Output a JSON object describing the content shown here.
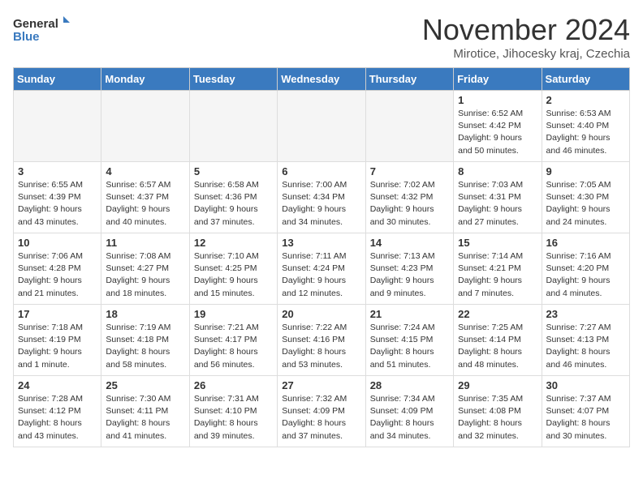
{
  "logo": {
    "text_general": "General",
    "text_blue": "Blue"
  },
  "header": {
    "month_year": "November 2024",
    "location": "Mirotice, Jihocesky kraj, Czechia"
  },
  "days_of_week": [
    "Sunday",
    "Monday",
    "Tuesday",
    "Wednesday",
    "Thursday",
    "Friday",
    "Saturday"
  ],
  "weeks": [
    [
      {
        "day": "",
        "info": ""
      },
      {
        "day": "",
        "info": ""
      },
      {
        "day": "",
        "info": ""
      },
      {
        "day": "",
        "info": ""
      },
      {
        "day": "",
        "info": ""
      },
      {
        "day": "1",
        "info": "Sunrise: 6:52 AM\nSunset: 4:42 PM\nDaylight: 9 hours and 50 minutes."
      },
      {
        "day": "2",
        "info": "Sunrise: 6:53 AM\nSunset: 4:40 PM\nDaylight: 9 hours and 46 minutes."
      }
    ],
    [
      {
        "day": "3",
        "info": "Sunrise: 6:55 AM\nSunset: 4:39 PM\nDaylight: 9 hours and 43 minutes."
      },
      {
        "day": "4",
        "info": "Sunrise: 6:57 AM\nSunset: 4:37 PM\nDaylight: 9 hours and 40 minutes."
      },
      {
        "day": "5",
        "info": "Sunrise: 6:58 AM\nSunset: 4:36 PM\nDaylight: 9 hours and 37 minutes."
      },
      {
        "day": "6",
        "info": "Sunrise: 7:00 AM\nSunset: 4:34 PM\nDaylight: 9 hours and 34 minutes."
      },
      {
        "day": "7",
        "info": "Sunrise: 7:02 AM\nSunset: 4:32 PM\nDaylight: 9 hours and 30 minutes."
      },
      {
        "day": "8",
        "info": "Sunrise: 7:03 AM\nSunset: 4:31 PM\nDaylight: 9 hours and 27 minutes."
      },
      {
        "day": "9",
        "info": "Sunrise: 7:05 AM\nSunset: 4:30 PM\nDaylight: 9 hours and 24 minutes."
      }
    ],
    [
      {
        "day": "10",
        "info": "Sunrise: 7:06 AM\nSunset: 4:28 PM\nDaylight: 9 hours and 21 minutes."
      },
      {
        "day": "11",
        "info": "Sunrise: 7:08 AM\nSunset: 4:27 PM\nDaylight: 9 hours and 18 minutes."
      },
      {
        "day": "12",
        "info": "Sunrise: 7:10 AM\nSunset: 4:25 PM\nDaylight: 9 hours and 15 minutes."
      },
      {
        "day": "13",
        "info": "Sunrise: 7:11 AM\nSunset: 4:24 PM\nDaylight: 9 hours and 12 minutes."
      },
      {
        "day": "14",
        "info": "Sunrise: 7:13 AM\nSunset: 4:23 PM\nDaylight: 9 hours and 9 minutes."
      },
      {
        "day": "15",
        "info": "Sunrise: 7:14 AM\nSunset: 4:21 PM\nDaylight: 9 hours and 7 minutes."
      },
      {
        "day": "16",
        "info": "Sunrise: 7:16 AM\nSunset: 4:20 PM\nDaylight: 9 hours and 4 minutes."
      }
    ],
    [
      {
        "day": "17",
        "info": "Sunrise: 7:18 AM\nSunset: 4:19 PM\nDaylight: 9 hours and 1 minute."
      },
      {
        "day": "18",
        "info": "Sunrise: 7:19 AM\nSunset: 4:18 PM\nDaylight: 8 hours and 58 minutes."
      },
      {
        "day": "19",
        "info": "Sunrise: 7:21 AM\nSunset: 4:17 PM\nDaylight: 8 hours and 56 minutes."
      },
      {
        "day": "20",
        "info": "Sunrise: 7:22 AM\nSunset: 4:16 PM\nDaylight: 8 hours and 53 minutes."
      },
      {
        "day": "21",
        "info": "Sunrise: 7:24 AM\nSunset: 4:15 PM\nDaylight: 8 hours and 51 minutes."
      },
      {
        "day": "22",
        "info": "Sunrise: 7:25 AM\nSunset: 4:14 PM\nDaylight: 8 hours and 48 minutes."
      },
      {
        "day": "23",
        "info": "Sunrise: 7:27 AM\nSunset: 4:13 PM\nDaylight: 8 hours and 46 minutes."
      }
    ],
    [
      {
        "day": "24",
        "info": "Sunrise: 7:28 AM\nSunset: 4:12 PM\nDaylight: 8 hours and 43 minutes."
      },
      {
        "day": "25",
        "info": "Sunrise: 7:30 AM\nSunset: 4:11 PM\nDaylight: 8 hours and 41 minutes."
      },
      {
        "day": "26",
        "info": "Sunrise: 7:31 AM\nSunset: 4:10 PM\nDaylight: 8 hours and 39 minutes."
      },
      {
        "day": "27",
        "info": "Sunrise: 7:32 AM\nSunset: 4:09 PM\nDaylight: 8 hours and 37 minutes."
      },
      {
        "day": "28",
        "info": "Sunrise: 7:34 AM\nSunset: 4:09 PM\nDaylight: 8 hours and 34 minutes."
      },
      {
        "day": "29",
        "info": "Sunrise: 7:35 AM\nSunset: 4:08 PM\nDaylight: 8 hours and 32 minutes."
      },
      {
        "day": "30",
        "info": "Sunrise: 7:37 AM\nSunset: 4:07 PM\nDaylight: 8 hours and 30 minutes."
      }
    ]
  ]
}
